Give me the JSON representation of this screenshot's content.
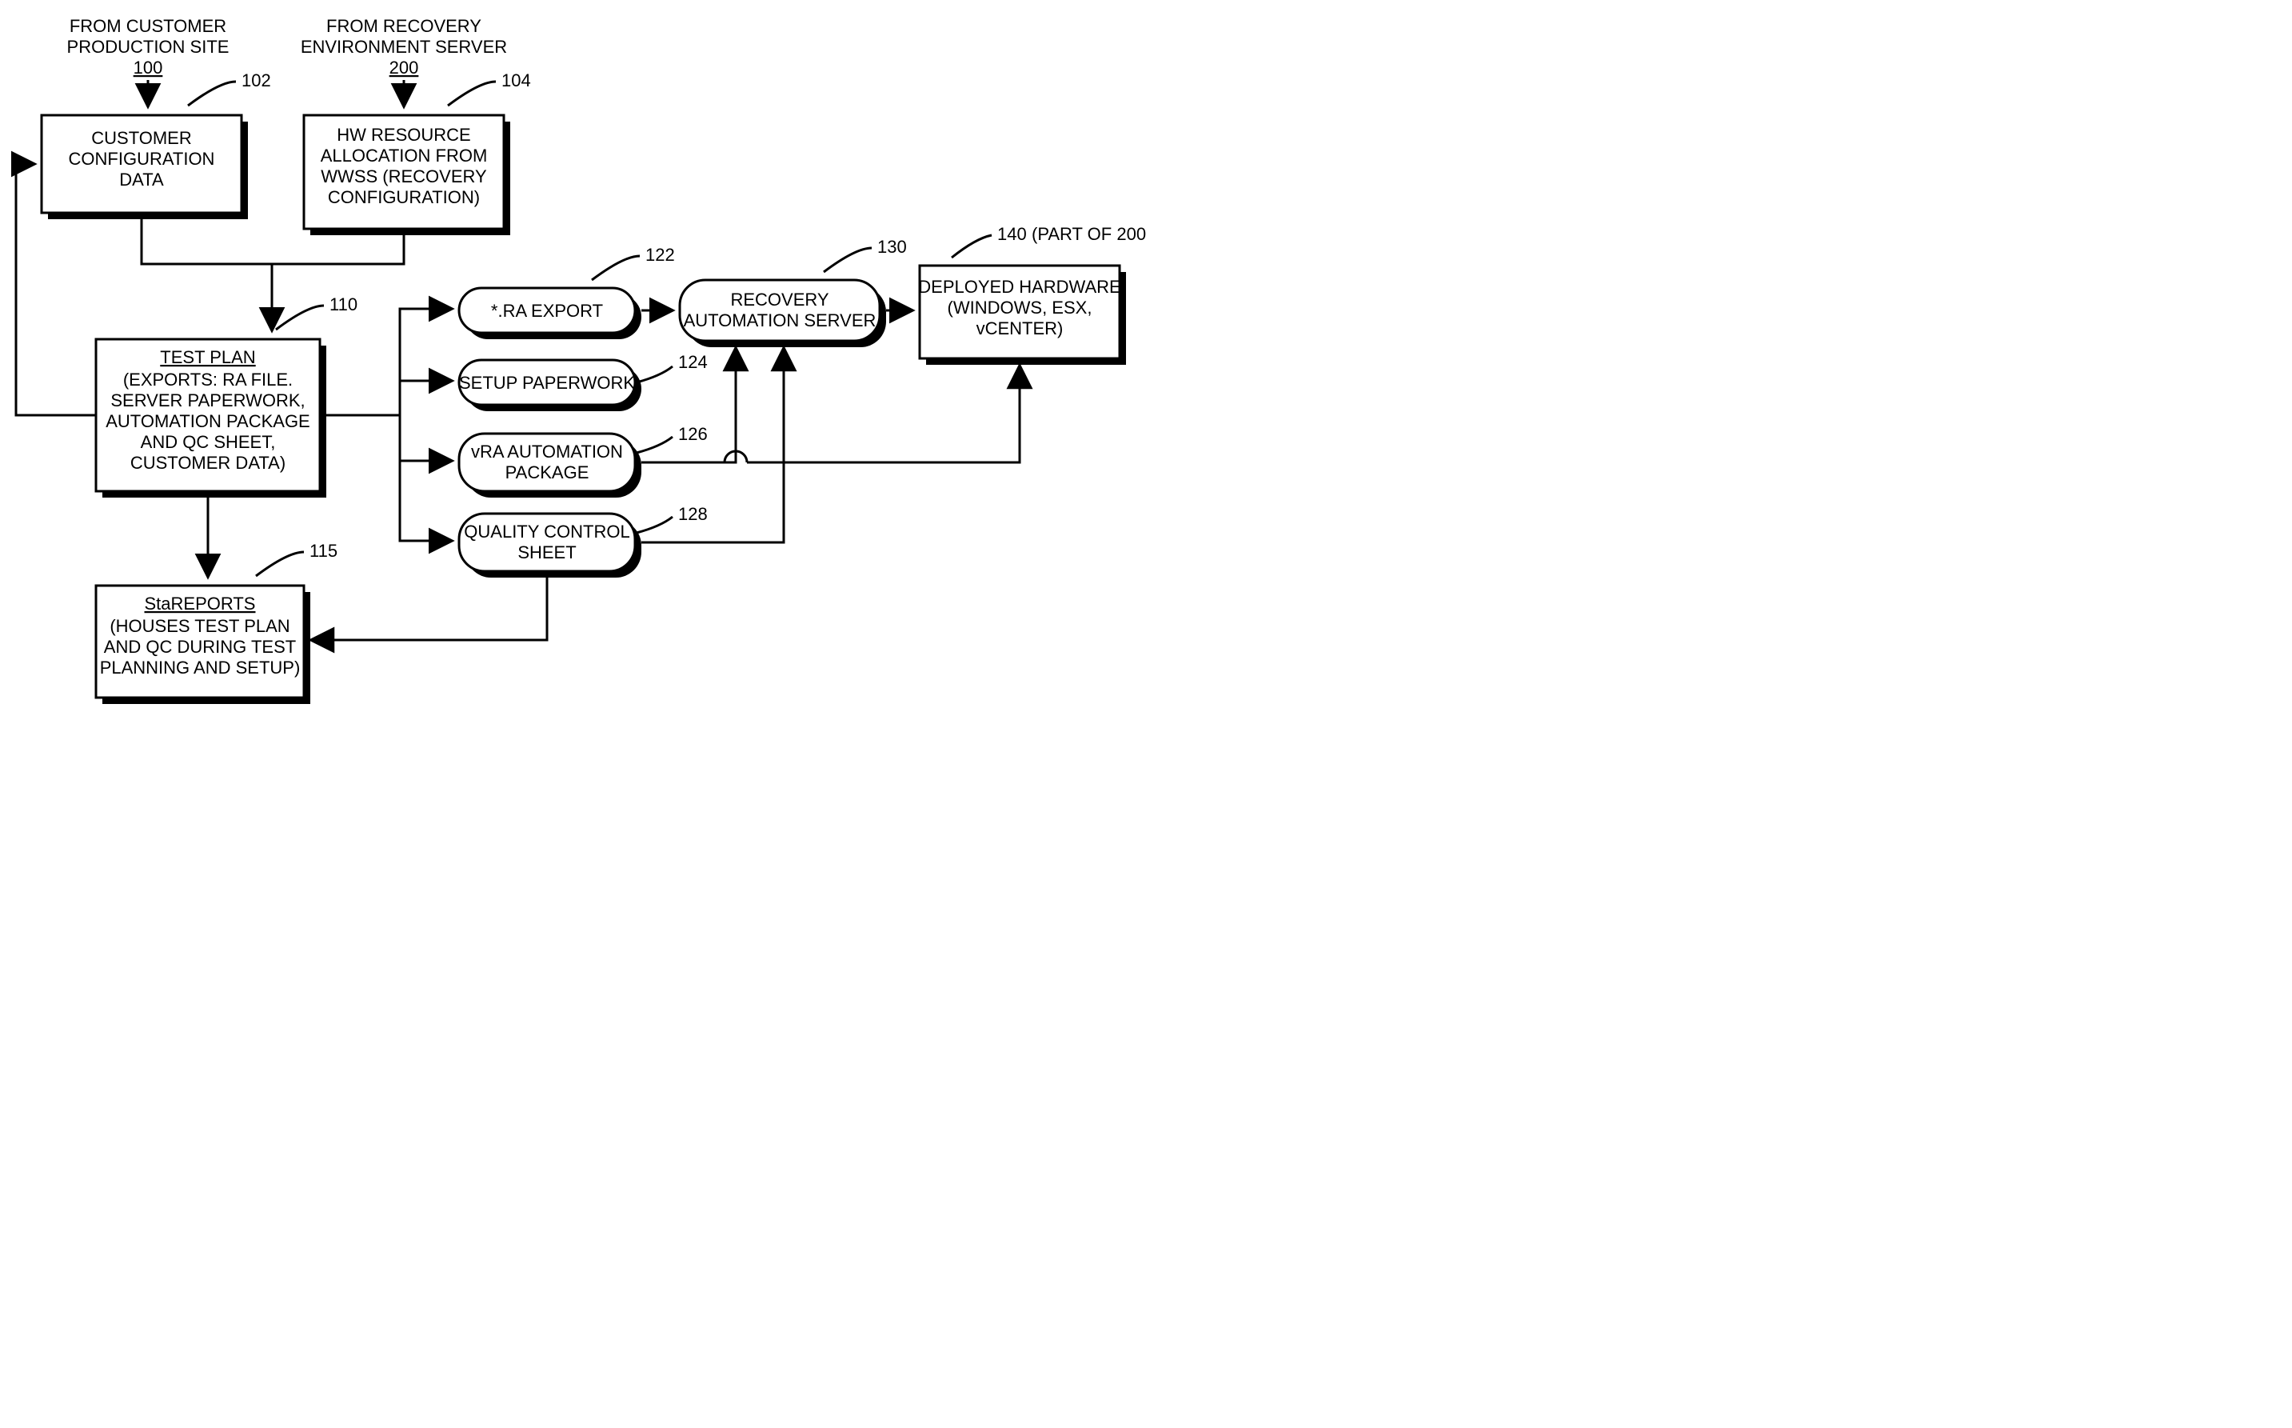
{
  "sources": {
    "customer": {
      "line1": "FROM CUSTOMER",
      "line2": "PRODUCTION SITE",
      "ref": "100"
    },
    "recovery": {
      "line1": "FROM RECOVERY",
      "line2": "ENVIRONMENT SERVER",
      "ref": "200"
    }
  },
  "nodes": {
    "cfg": {
      "ref": "102",
      "l1": "CUSTOMER",
      "l2": "CONFIGURATION",
      "l3": "DATA"
    },
    "hw": {
      "ref": "104",
      "l1": "HW RESOURCE",
      "l2": "ALLOCATION FROM",
      "l3": "WWSS (RECOVERY",
      "l4": "CONFIGURATION)"
    },
    "plan": {
      "ref": "110",
      "title": "TEST PLAN",
      "l1": "(EXPORTS: RA FILE.",
      "l2": "SERVER PAPERWORK,",
      "l3": "AUTOMATION PACKAGE",
      "l4": "AND QC SHEET,",
      "l5": "CUSTOMER DATA)"
    },
    "star": {
      "ref": "115",
      "title": "StaREPORTS",
      "l1": "(HOUSES TEST PLAN",
      "l2": "AND QC DURING TEST",
      "l3": "PLANNING AND SETUP)"
    },
    "ra": {
      "ref": "122",
      "l1": "*.RA EXPORT"
    },
    "paper": {
      "ref": "124",
      "l1": "SETUP PAPERWORK"
    },
    "vra": {
      "ref": "126",
      "l1": "vRA AUTOMATION",
      "l2": "PACKAGE"
    },
    "qc": {
      "ref": "128",
      "l1": "QUALITY CONTROL",
      "l2": "SHEET"
    },
    "srv": {
      "ref": "130",
      "l1": "RECOVERY",
      "l2": "AUTOMATION SERVER"
    },
    "dep": {
      "ref": "140",
      "note": "(PART OF 200)",
      "l1": "DEPLOYED HARDWARE",
      "l2": "(WINDOWS, ESX,",
      "l3": "vCENTER)"
    }
  }
}
